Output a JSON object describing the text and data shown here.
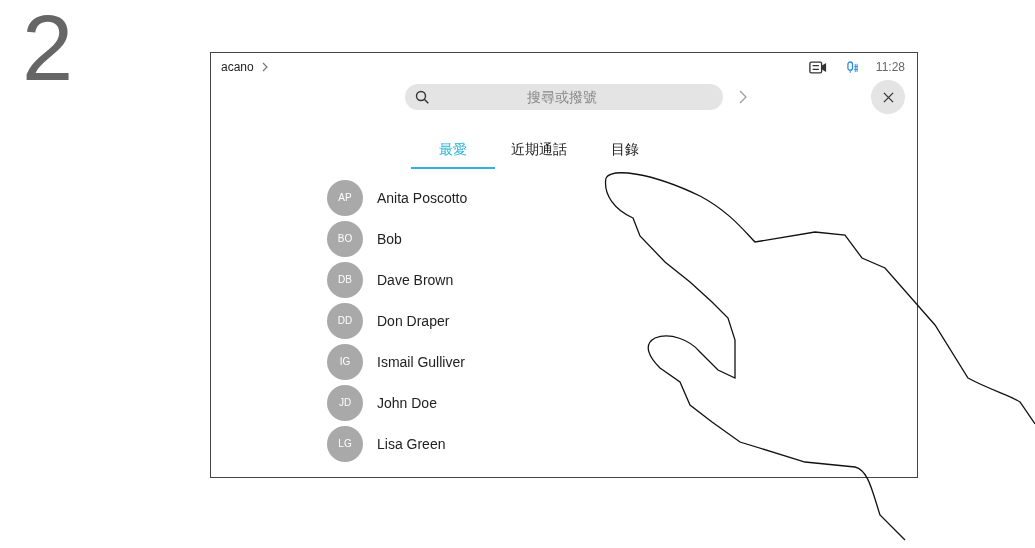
{
  "step": "2",
  "header": {
    "breadcrumb": "acano",
    "time": "11:28"
  },
  "search": {
    "placeholder": "搜尋或撥號"
  },
  "tabs": [
    {
      "label": "最愛",
      "selected": true
    },
    {
      "label": "近期通話",
      "selected": false
    },
    {
      "label": "目錄",
      "selected": false
    }
  ],
  "contacts": [
    {
      "initials": "AP",
      "name": "Anita Poscotto"
    },
    {
      "initials": "BO",
      "name": "Bob"
    },
    {
      "initials": "DB",
      "name": "Dave Brown"
    },
    {
      "initials": "DD",
      "name": "Don Draper"
    },
    {
      "initials": "IG",
      "name": "Ismail Gulliver"
    },
    {
      "initials": "JD",
      "name": "John Doe"
    },
    {
      "initials": "LG",
      "name": "Lisa Green"
    }
  ]
}
